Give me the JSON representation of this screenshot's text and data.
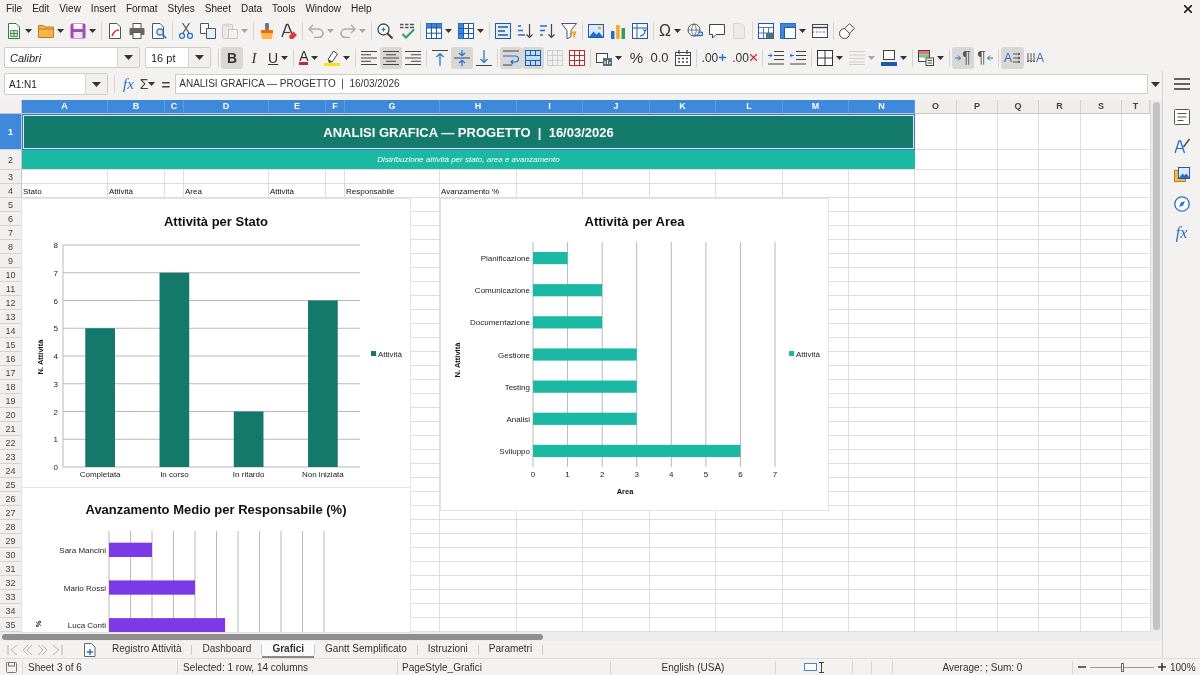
{
  "menu": [
    "File",
    "Edit",
    "View",
    "Insert",
    "Format",
    "Styles",
    "Sheet",
    "Data",
    "Tools",
    "Window",
    "Help"
  ],
  "standard_toolbar": [
    {
      "kind": "new",
      "disabled": false
    },
    {
      "kind": "open",
      "disabled": false
    },
    {
      "kind": "save",
      "disabled": false
    },
    {
      "kind": "export_pdf",
      "disabled": false
    },
    {
      "kind": "print",
      "disabled": false
    },
    {
      "kind": "print_preview",
      "disabled": false
    },
    {
      "kind": "cut",
      "disabled": false
    },
    {
      "kind": "copy",
      "disabled": false
    },
    {
      "kind": "paste",
      "disabled": true
    },
    {
      "kind": "clone",
      "disabled": false
    },
    {
      "kind": "clear",
      "disabled": false
    },
    {
      "kind": "undo",
      "disabled": true
    },
    {
      "kind": "redo",
      "disabled": true
    },
    {
      "kind": "find",
      "disabled": false
    },
    {
      "kind": "spelling",
      "disabled": false
    },
    {
      "kind": "rows",
      "disabled": false
    },
    {
      "kind": "columns",
      "disabled": false
    },
    {
      "kind": "sort",
      "disabled": false
    },
    {
      "kind": "sort_asc",
      "disabled": false
    },
    {
      "kind": "sort_desc",
      "disabled": false
    },
    {
      "kind": "filter",
      "disabled": false
    },
    {
      "kind": "image",
      "disabled": false
    },
    {
      "kind": "chart",
      "disabled": false
    },
    {
      "kind": "pivot",
      "disabled": false
    },
    {
      "kind": "special",
      "label": "Ω",
      "disabled": false
    },
    {
      "kind": "hyperlink",
      "disabled": false
    },
    {
      "kind": "comment",
      "disabled": false
    },
    {
      "kind": "header_footer",
      "disabled": true
    },
    {
      "kind": "print_area",
      "disabled": false
    },
    {
      "kind": "freeze",
      "disabled": false
    },
    {
      "kind": "split",
      "disabled": false
    },
    {
      "kind": "shapes",
      "disabled": false
    }
  ],
  "formatting_toolbar": {
    "font_name": "Calibri",
    "font_size": "16 pt",
    "buttons": [
      {
        "kind": "bold",
        "label": "B",
        "on": true,
        "disabled": false
      },
      {
        "kind": "italic",
        "label": "I",
        "on": false,
        "disabled": false
      },
      {
        "kind": "underline",
        "label": "U",
        "on": false,
        "disabled": false
      },
      {
        "kind": "font_color",
        "label": "A",
        "on": false,
        "disabled": false
      },
      {
        "kind": "highlight",
        "on": false,
        "disabled": false
      },
      {
        "kind": "align_left",
        "on": false,
        "disabled": false
      },
      {
        "kind": "align_center",
        "on": true,
        "disabled": false
      },
      {
        "kind": "align_right",
        "on": false,
        "disabled": false
      },
      {
        "kind": "align_top",
        "on": false,
        "disabled": false
      },
      {
        "kind": "align_middle",
        "on": true,
        "disabled": false
      },
      {
        "kind": "align_bottom",
        "on": false,
        "disabled": false
      },
      {
        "kind": "wrap",
        "on": true,
        "disabled": false
      },
      {
        "kind": "merge_center",
        "on": true,
        "disabled": false
      },
      {
        "kind": "merge",
        "on": false,
        "disabled": true
      },
      {
        "kind": "unmerge",
        "on": false,
        "disabled": false
      },
      {
        "kind": "currency",
        "on": false,
        "disabled": false
      },
      {
        "kind": "percent",
        "label": "%",
        "on": false,
        "disabled": false
      },
      {
        "kind": "number",
        "label": "0.0",
        "on": false,
        "disabled": false
      },
      {
        "kind": "date",
        "on": false,
        "disabled": false
      },
      {
        "kind": "add_decimal",
        "label": ".00",
        "on": false,
        "disabled": false
      },
      {
        "kind": "del_decimal",
        "label": ".00",
        "on": false,
        "disabled": false
      },
      {
        "kind": "indent",
        "on": false,
        "disabled": false
      },
      {
        "kind": "outdent",
        "on": false,
        "disabled": false
      },
      {
        "kind": "borders",
        "on": false,
        "disabled": false
      },
      {
        "kind": "border_style",
        "on": false,
        "disabled": true
      },
      {
        "kind": "border_color",
        "on": false,
        "disabled": false
      },
      {
        "kind": "conditional",
        "on": false,
        "disabled": false
      },
      {
        "kind": "ltr",
        "label": "¶",
        "on": true,
        "disabled": false
      },
      {
        "kind": "rtl",
        "label": "¶",
        "on": false,
        "disabled": false
      },
      {
        "kind": "text_ltr",
        "label": "A",
        "on": true,
        "disabled": false
      },
      {
        "kind": "text_ttb",
        "label": "A",
        "on": false,
        "disabled": false
      }
    ]
  },
  "formula_bar": {
    "name_box": "A1:N1",
    "buttons": [
      {
        "kind": "function_wizard",
        "label": "fx"
      },
      {
        "kind": "sum",
        "label": "Σ"
      },
      {
        "kind": "formula",
        "label": "="
      }
    ],
    "content": "ANALISI GRAFICA — PROGETTO  |  16/03/2026"
  },
  "sidebar": [
    {
      "kind": "menu"
    },
    {
      "kind": "properties"
    },
    {
      "kind": "styles"
    },
    {
      "kind": "gallery"
    },
    {
      "kind": "navigator"
    },
    {
      "kind": "functions",
      "label": "fx"
    }
  ],
  "sheet": {
    "columns": [
      {
        "label": "A",
        "selected": true,
        "row_4": "Stato"
      },
      {
        "label": "B",
        "selected": true,
        "row_4": "Attività"
      },
      {
        "label": "C",
        "selected": true
      },
      {
        "label": "D",
        "selected": true,
        "row_4": "Area"
      },
      {
        "label": "E",
        "selected": true,
        "row_4": "Attività"
      },
      {
        "label": "F",
        "selected": true
      },
      {
        "label": "G",
        "selected": true,
        "row_4": "Responsabile"
      },
      {
        "label": "H",
        "selected": true,
        "row_4": "Avanzamento %"
      },
      {
        "label": "I",
        "selected": true
      },
      {
        "label": "J",
        "selected": true
      },
      {
        "label": "K",
        "selected": true
      },
      {
        "label": "L",
        "selected": true
      },
      {
        "label": "M",
        "selected": true
      },
      {
        "label": "N",
        "selected": true
      },
      {
        "label": "O",
        "selected": false
      },
      {
        "label": "P",
        "selected": false
      },
      {
        "label": "Q",
        "selected": false
      },
      {
        "label": "R",
        "selected": false
      },
      {
        "label": "S",
        "selected": false
      },
      {
        "label": "T",
        "selected": false
      }
    ],
    "rows": [
      {
        "label": "1",
        "selected": true
      },
      {
        "label": "2",
        "selected": false
      },
      {
        "label": "3",
        "selected": false
      },
      {
        "label": "4",
        "selected": false
      },
      {
        "label": "5",
        "selected": false
      },
      {
        "label": "6",
        "selected": false
      },
      {
        "label": "7",
        "selected": false
      },
      {
        "label": "8",
        "selected": false
      },
      {
        "label": "9",
        "selected": false
      },
      {
        "label": "10",
        "selected": false
      },
      {
        "label": "11",
        "selected": false
      },
      {
        "label": "12",
        "selected": false
      },
      {
        "label": "13",
        "selected": false
      },
      {
        "label": "14",
        "selected": false
      },
      {
        "label": "15",
        "selected": false
      },
      {
        "label": "16",
        "selected": false
      },
      {
        "label": "17",
        "selected": false
      },
      {
        "label": "18",
        "selected": false
      },
      {
        "label": "19",
        "selected": false
      },
      {
        "label": "20",
        "selected": false
      },
      {
        "label": "21",
        "selected": false
      },
      {
        "label": "22",
        "selected": false
      },
      {
        "label": "23",
        "selected": false
      },
      {
        "label": "24",
        "selected": false
      },
      {
        "label": "25",
        "selected": false
      },
      {
        "label": "26",
        "selected": false
      },
      {
        "label": "27",
        "selected": false
      },
      {
        "label": "28",
        "selected": false
      },
      {
        "label": "29",
        "selected": false
      },
      {
        "label": "30",
        "selected": false
      },
      {
        "label": "31",
        "selected": false
      },
      {
        "label": "32",
        "selected": false
      },
      {
        "label": "33",
        "selected": false
      },
      {
        "label": "34",
        "selected": false
      },
      {
        "label": "35",
        "selected": false
      }
    ],
    "title": {
      "text": "ANALISI GRAFICA — PROGETTO  |  16/03/2026",
      "selected": true
    },
    "subtitle": "Distribuzione attività per stato, area e avanzamento"
  },
  "charts": [
    {
      "chart_data": {
        "type": "bar",
        "orientation": "vertical",
        "title": "Attività per Stato",
        "ylabel": "N. Attività",
        "categories": [
          "Completata",
          "In corso",
          "In ritardo",
          "Non iniziata"
        ],
        "series": [
          {
            "name": "Attività",
            "color": "#14786b",
            "values": [
              5,
              7,
              2,
              6
            ]
          }
        ],
        "ylim": [
          0,
          8
        ],
        "yticks": [
          0,
          1,
          2,
          3,
          4,
          5,
          6,
          7,
          8
        ],
        "grid": true
      }
    },
    {
      "chart_data": {
        "type": "bar",
        "orientation": "horizontal",
        "title": "Attività per Area",
        "xlabel": "Area",
        "ylabel": "N. Attività",
        "categories": [
          "Pianificazione",
          "Comunicazione",
          "Documentazione",
          "Gestione",
          "Testing",
          "Analisi",
          "Sviluppo"
        ],
        "series": [
          {
            "name": "Attività",
            "color": "#1bb9a3",
            "values": [
              1,
              2,
              2,
              3,
              3,
              3,
              6
            ]
          }
        ],
        "xlim": [
          0,
          7
        ],
        "xticks": [
          0,
          1,
          2,
          3,
          4,
          5,
          6,
          7
        ],
        "grid": true
      }
    }
  ],
  "progress_chart": {
    "title": "Avanzamento Medio per Responsabile (%)",
    "axis_title": "%",
    "labels": [
      "Sara Mancini",
      "Mario Rossi",
      "Luca Conti"
    ]
  },
  "sheet_tabs": [
    {
      "label": "Registro Attività",
      "selected": false
    },
    {
      "label": "Dashboard",
      "selected": false
    },
    {
      "label": "Grafici",
      "selected": true
    },
    {
      "label": "Gantt Semplificato",
      "selected": false
    },
    {
      "label": "Istruzioni",
      "selected": false
    },
    {
      "label": "Parametri",
      "selected": false
    }
  ],
  "status_bar": {
    "sheet": "Sheet 3 of 6",
    "selection": "Selected: 1 row, 14 columns",
    "page_style": "PageStyle_Grafici",
    "language": "English (USA)",
    "summary": "Average: ; Sum: 0",
    "zoom": {
      "level": 0.5,
      "label": "100%"
    }
  }
}
